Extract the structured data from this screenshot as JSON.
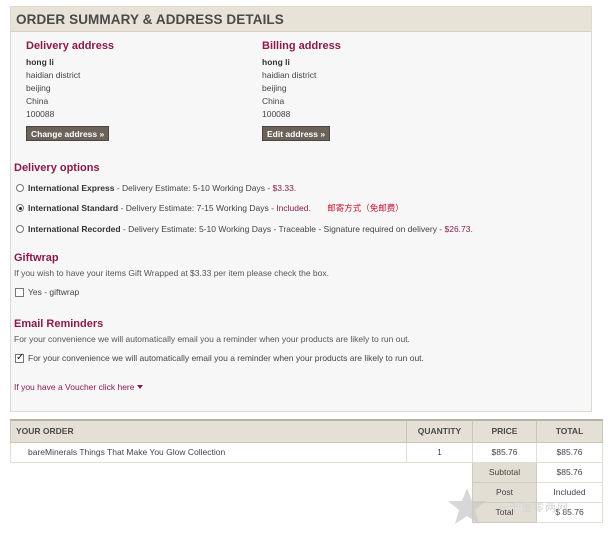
{
  "header": {
    "title": "ORDER SUMMARY & ADDRESS DETAILS"
  },
  "delivery_address": {
    "title": "Delivery address",
    "name": "hong li",
    "line1": "haidian district",
    "city": "beijing",
    "country": "China",
    "postcode": "100088",
    "button": "Change address »"
  },
  "billing_address": {
    "title": "Billing address",
    "name": "hong li",
    "line1": "haidian district",
    "city": "beijing",
    "country": "China",
    "postcode": "100088",
    "button": "Edit address »"
  },
  "delivery_options": {
    "title": "Delivery options",
    "options": [
      {
        "name": "International Express",
        "detail": " - Delivery Estimate: 5-10 Working Days - ",
        "price": "$3.33",
        "suffix": ".",
        "selected": false
      },
      {
        "name": "International Standard",
        "detail": " - Delivery Estimate: 7-15 Working Days - ",
        "price": "Included",
        "suffix": ".",
        "selected": true
      },
      {
        "name": "International Recorded",
        "detail": " - Delivery Estimate: 5-10 Working Days - Traceable - Signature required on delivery - ",
        "price": "$26.73",
        "suffix": ".",
        "selected": false
      }
    ],
    "note": "邮寄方式（免邮费）"
  },
  "giftwrap": {
    "title": "Giftwrap",
    "description": "If you wish to have your items Gift Wrapped at $3.33 per item please check the box.",
    "checkbox_label": "Yes - giftwrap",
    "checked": false
  },
  "email_reminders": {
    "title": "Email Reminders",
    "description": "For your convenience we will automatically email you a reminder when your products are likely to run out.",
    "checkbox_label": "For your convenience we will automatically email you a reminder when your products are likely to run out.",
    "checked": true
  },
  "voucher": {
    "label": "If you have a Voucher click here"
  },
  "order_table": {
    "headers": {
      "order": "YOUR ORDER",
      "quantity": "QUANTITY",
      "price": "PRICE",
      "total": "TOTAL"
    },
    "items": [
      {
        "name": "bareMinerals Things That Make You Glow Collection",
        "quantity": "1",
        "price": "$85.76",
        "total": "$85.76"
      }
    ],
    "summary": {
      "subtotal_label": "Subtotal",
      "subtotal_value": "$85.76",
      "post_label": "Post",
      "post_value": "Included",
      "total_label": "Total",
      "total_value": "$ 85.76"
    }
  },
  "watermark": {
    "text": "一千里零两网"
  },
  "colors": {
    "accent": "#8b1a4a",
    "button_bg": "#6b625a",
    "header_bg": "#e7e3d7",
    "note_red": "#c8102e"
  }
}
